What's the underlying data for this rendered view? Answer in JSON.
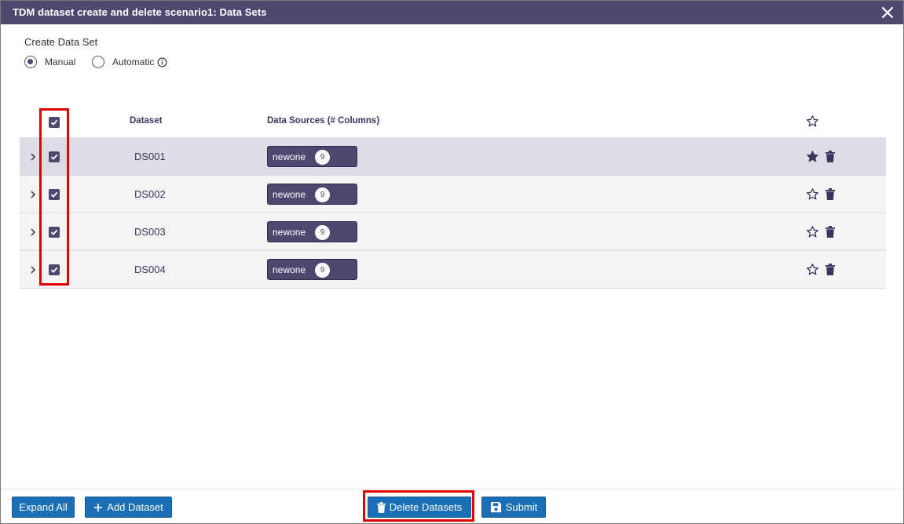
{
  "dialog": {
    "title": "TDM dataset create and delete scenario1: Data Sets",
    "close_icon": "close-icon"
  },
  "create": {
    "label": "Create Data Set",
    "options": [
      {
        "label": "Manual",
        "selected": true
      },
      {
        "label": "Automatic",
        "selected": false
      }
    ]
  },
  "table": {
    "headers": {
      "dataset": "Dataset",
      "data_sources": "Data Sources (# Columns)"
    },
    "rows": [
      {
        "dataset": "DS001",
        "source": "newone",
        "columns": "9",
        "checked": true,
        "starred": true
      },
      {
        "dataset": "DS002",
        "source": "newone",
        "columns": "9",
        "checked": true,
        "starred": false
      },
      {
        "dataset": "DS003",
        "source": "newone",
        "columns": "9",
        "checked": true,
        "starred": false
      },
      {
        "dataset": "DS004",
        "source": "newone",
        "columns": "9",
        "checked": true,
        "starred": false
      }
    ]
  },
  "footer": {
    "expand_all": "Expand All",
    "add_dataset": "Add Dataset",
    "delete_datasets": "Delete Datasets",
    "submit": "Submit"
  },
  "colors": {
    "header_bg": "#4e4870",
    "button_bg": "#1a6fb5",
    "highlight_box": "#e00000"
  }
}
